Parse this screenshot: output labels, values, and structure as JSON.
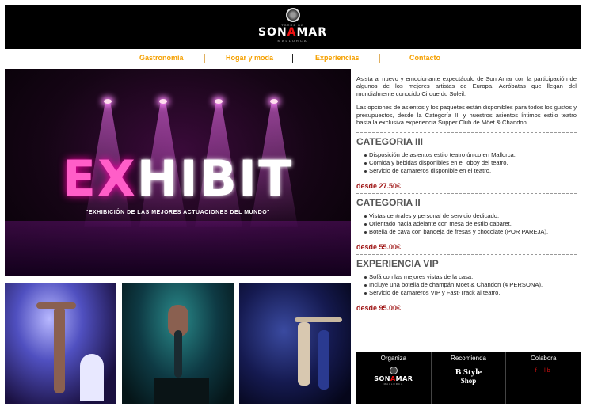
{
  "header": {
    "logo_top": "TORRE DE",
    "logo_name_pre": "SON",
    "logo_name_mid": "A",
    "logo_name_post": "MAR",
    "logo_sub": "MALLORCA"
  },
  "nav": {
    "items": [
      "Gastronomía",
      "Hogar y moda",
      "Experiencias",
      "Contacto"
    ]
  },
  "hero": {
    "title_pink": "EX",
    "title_white1": "HI",
    "title_white2": "BIT",
    "tagline": "\"EXHIBICIÓN DE LAS MEJORES ACTUACIONES DEL MUNDO\""
  },
  "intro": {
    "p1": "Asista al nuevo y emocionante expectáculo de Son Amar con la participación de algunos de los mejores artistas de Europa. Acróbatas que llegan del mundialmente conocido Cirque du Soleil.",
    "p2": "Las opciones de asientos y los paquetes están disponibles para todos los gustos y presupuestos, desde la Categoría III y nuestros asientos íntimos estilo teatro hasta la exclusiva experiencia Supper Club de Möet & Chandon."
  },
  "categories": [
    {
      "title": "CATEGORIA III",
      "items": [
        "Disposición de asientos estilo teatro único en Mallorca.",
        "Comida y bebidas disponibles en el lobby del teatro.",
        "Servicio de camareros disponible en el teatro."
      ],
      "price": "desde 27.50€"
    },
    {
      "title": "CATEGORIA II",
      "items": [
        "Vistas centrales y personal de servicio dedicado.",
        "Orientado hacia adelante con mesa de estilo cabaret.",
        "Botella de cava con bandeja de fresas y chocolate (POR PAREJA)."
      ],
      "price": "desde 55.00€"
    },
    {
      "title": "EXPERIENCIA VIP",
      "items": [
        "Sofá con las mejores vistas de la casa.",
        "Incluye una botella de champán Möet & Chandon (4 PERSONA).",
        "Servicio de camareros VIP y Fast-Track al teatro."
      ],
      "price": "desde 95.00€"
    }
  ],
  "footer": {
    "col1_head": "Organiza",
    "col1_logo_pre": "SON",
    "col1_logo_mid": "A",
    "col1_logo_post": "MAR",
    "col1_logo_sub": "MALLORCA",
    "col2_head": "Recomienda",
    "col2_logo_line1": "B Style",
    "col2_logo_line2": "Shop",
    "col3_head": "Colabora",
    "col3_logo": "fi   lb"
  },
  "colors": {
    "nav_accent": "#f5a000",
    "price": "#a01818",
    "header_bg": "#000000",
    "neon_pink": "#ff5ec8"
  },
  "icons": [
    "son-amar-crest-icon"
  ]
}
